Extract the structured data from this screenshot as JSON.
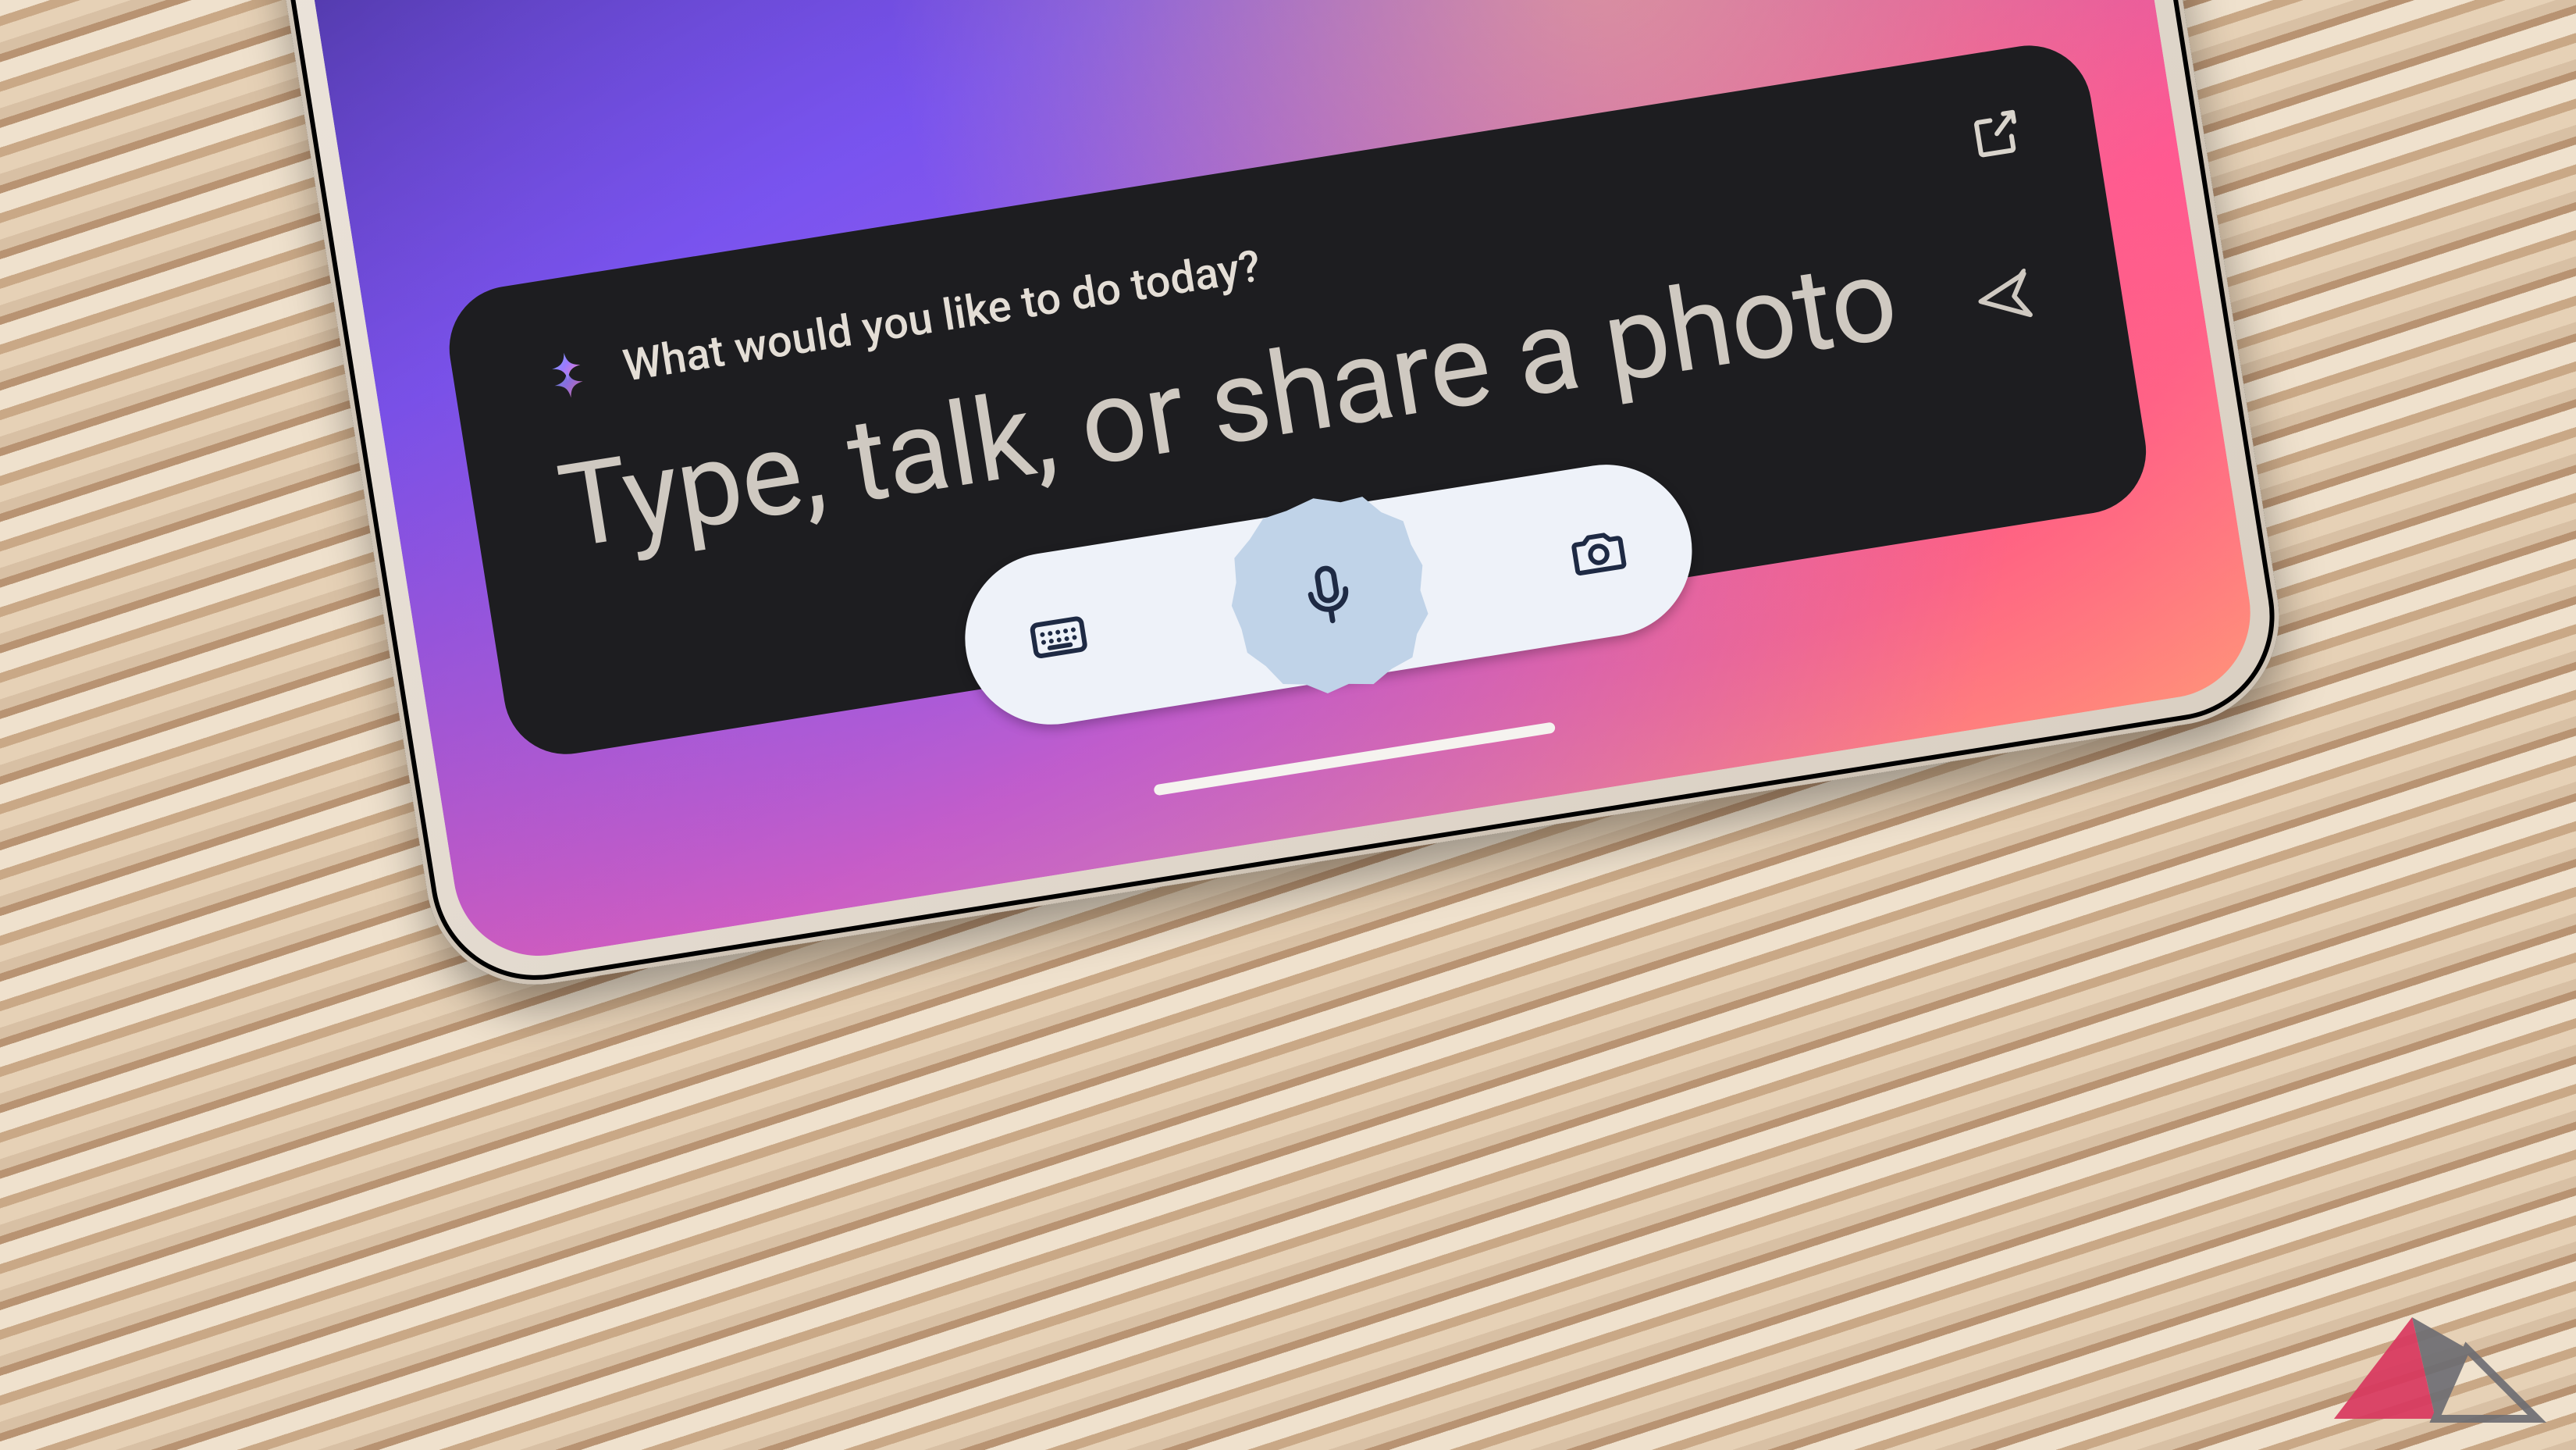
{
  "card": {
    "header": "What would you like to do today?",
    "prompt": "Type, talk, or share a photo"
  },
  "icons": {
    "sparkle": "sparkle-icon",
    "expand": "open-in-new-icon",
    "send": "send-icon",
    "keyboard": "keyboard-icon",
    "mic": "microphone-icon",
    "camera": "camera-icon"
  }
}
